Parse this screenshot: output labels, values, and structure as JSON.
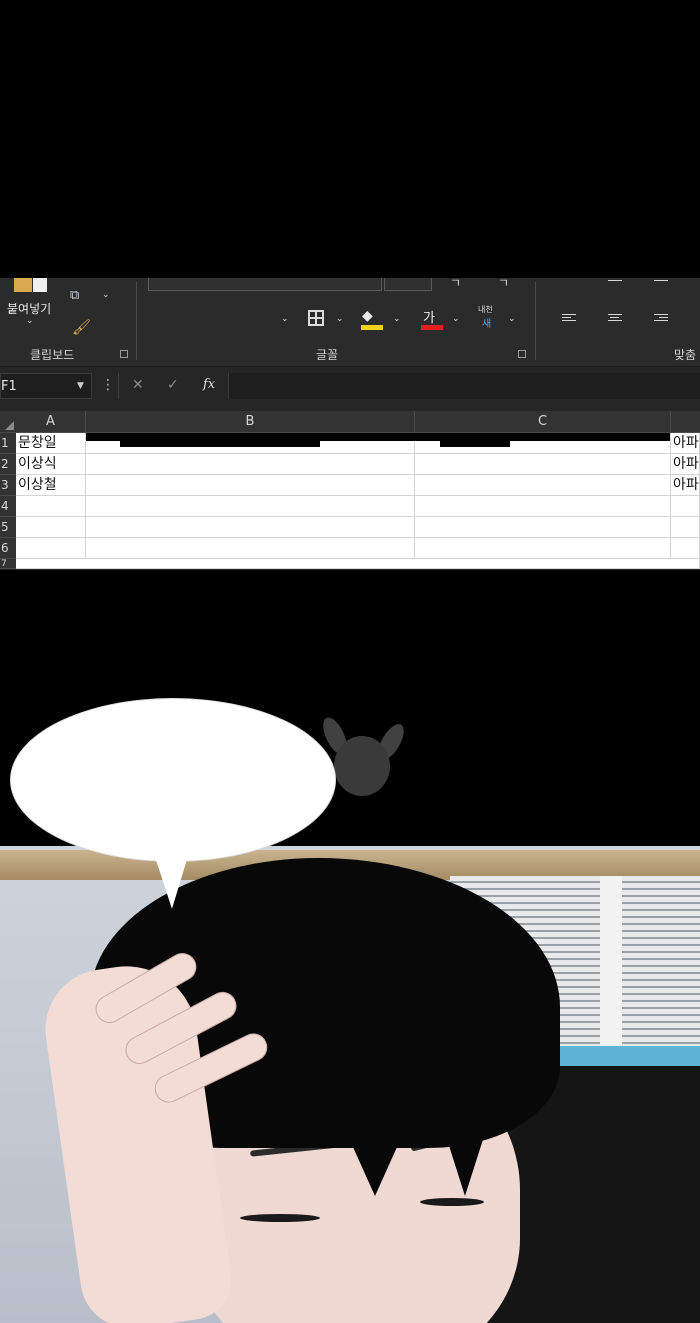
{
  "ribbon": {
    "clipboard": {
      "paste_label": "붙여넣기",
      "group_label": "클립보드",
      "paste_icon": "paste-clipboard-icon",
      "copy_icon": "copy-icon",
      "format_painter_icon": "format-painter-brush-icon"
    },
    "font": {
      "group_label": "글꼴",
      "font_color_label": "가",
      "phonetic_top": "내천",
      "phonetic_bottom": "새",
      "fill_color": "#f3d21b",
      "font_color": "#e0201e"
    },
    "alignment": {
      "group_label": "맞춤"
    }
  },
  "formula_bar": {
    "name_box": "F1",
    "cancel_glyph": "✕",
    "enter_glyph": "✓",
    "fx_label": "fx",
    "formula_value": ""
  },
  "sheet": {
    "columns": [
      "A",
      "B",
      "C"
    ],
    "rows": [
      {
        "num": "1",
        "a": "문창일",
        "d": "아파"
      },
      {
        "num": "2",
        "a": "이상식",
        "d": "아파"
      },
      {
        "num": "3",
        "a": "이상철",
        "d": "아파"
      },
      {
        "num": "4",
        "a": "",
        "d": ""
      },
      {
        "num": "5",
        "a": "",
        "d": ""
      },
      {
        "num": "6",
        "a": "",
        "d": ""
      },
      {
        "num": "7",
        "a": "",
        "d": ""
      }
    ]
  },
  "comic": {
    "speech_bubble_text": "",
    "watermark_icon": "bunny-mascot-watermark-icon"
  }
}
